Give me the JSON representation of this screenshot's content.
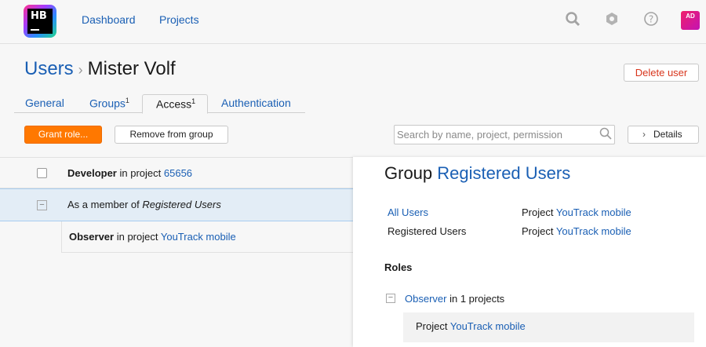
{
  "logo": {
    "text": "HB"
  },
  "nav": {
    "dashboard": "Dashboard",
    "projects": "Projects"
  },
  "header_icons": [
    "search-icon",
    "gear-icon",
    "help-icon"
  ],
  "user_avatar": "AD",
  "breadcrumb": {
    "parent": "Users",
    "separator": "›",
    "current": "Mister Volf"
  },
  "delete_button": "Delete user",
  "tabs": [
    {
      "label": "General",
      "count": ""
    },
    {
      "label": "Groups",
      "count": "1"
    },
    {
      "label": "Access",
      "count": "1",
      "active": true
    },
    {
      "label": "Authentication",
      "count": ""
    }
  ],
  "toolbar": {
    "grant_role": "Grant role...",
    "remove_from_group": "Remove from group",
    "search_placeholder": "Search by name, project, permission",
    "details": "Details"
  },
  "access_rows": {
    "developer": {
      "role": "Developer",
      "mid": "in project",
      "project": "65656"
    },
    "member": {
      "prefix": "As a member of",
      "group": "Registered Users"
    },
    "observer": {
      "role": "Observer",
      "mid": "in project",
      "project": "YouTrack mobile"
    }
  },
  "detail_panel": {
    "title_prefix": "Group",
    "title_group": "Registered Users",
    "groups": [
      {
        "name": "All Users",
        "project_label": "Project",
        "project": "YouTrack mobile"
      },
      {
        "name": "Registered Users",
        "project_label": "Project",
        "project": "YouTrack mobile"
      }
    ],
    "roles_heading": "Roles",
    "role": {
      "name": "Observer",
      "suffix": "in 1 projects"
    },
    "role_project": {
      "label": "Project",
      "name": "YouTrack mobile"
    }
  },
  "colors": {
    "accent": "#ff7800",
    "link": "#1a5fb4",
    "danger": "#d8351c",
    "selection": "#e3edf6"
  }
}
